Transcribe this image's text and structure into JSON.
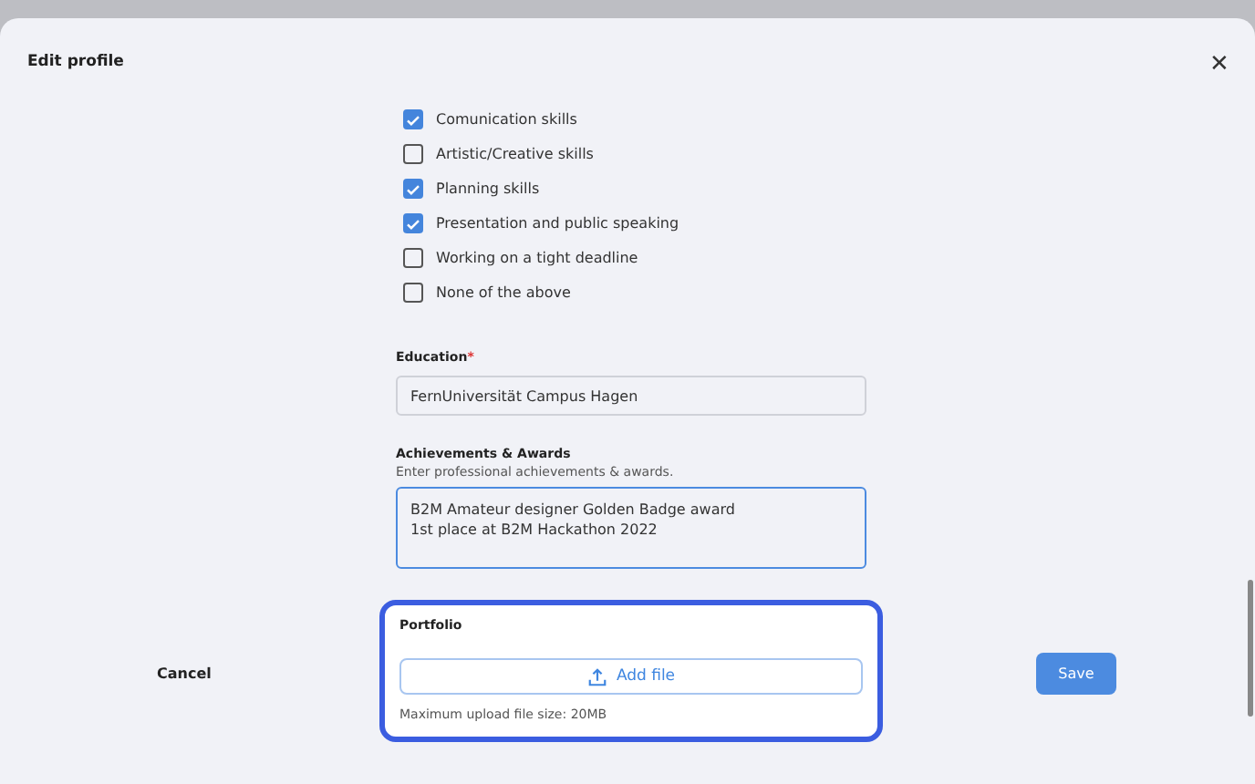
{
  "dialog": {
    "title": "Edit profile",
    "close": "✕"
  },
  "skills": [
    {
      "label": "Comunication skills",
      "checked": true
    },
    {
      "label": "Artistic/Creative skills",
      "checked": false
    },
    {
      "label": "Planning skills",
      "checked": true
    },
    {
      "label": "Presentation and public speaking",
      "checked": true
    },
    {
      "label": "Working on a tight deadline",
      "checked": false
    },
    {
      "label": "None of the above",
      "checked": false
    }
  ],
  "education": {
    "label": "Education",
    "required_mark": "*",
    "value": "FernUniversität Campus Hagen"
  },
  "achievements": {
    "label": "Achievements & Awards",
    "hint": "Enter professional achievements & awards.",
    "value": "B2M Amateur designer Golden Badge award\n1st place at B2M Hackathon 2022"
  },
  "portfolio": {
    "label": "Portfolio",
    "button": "Add file",
    "note": "Maximum upload file size: 20MB"
  },
  "footer": {
    "cancel": "Cancel",
    "save": "Save"
  }
}
